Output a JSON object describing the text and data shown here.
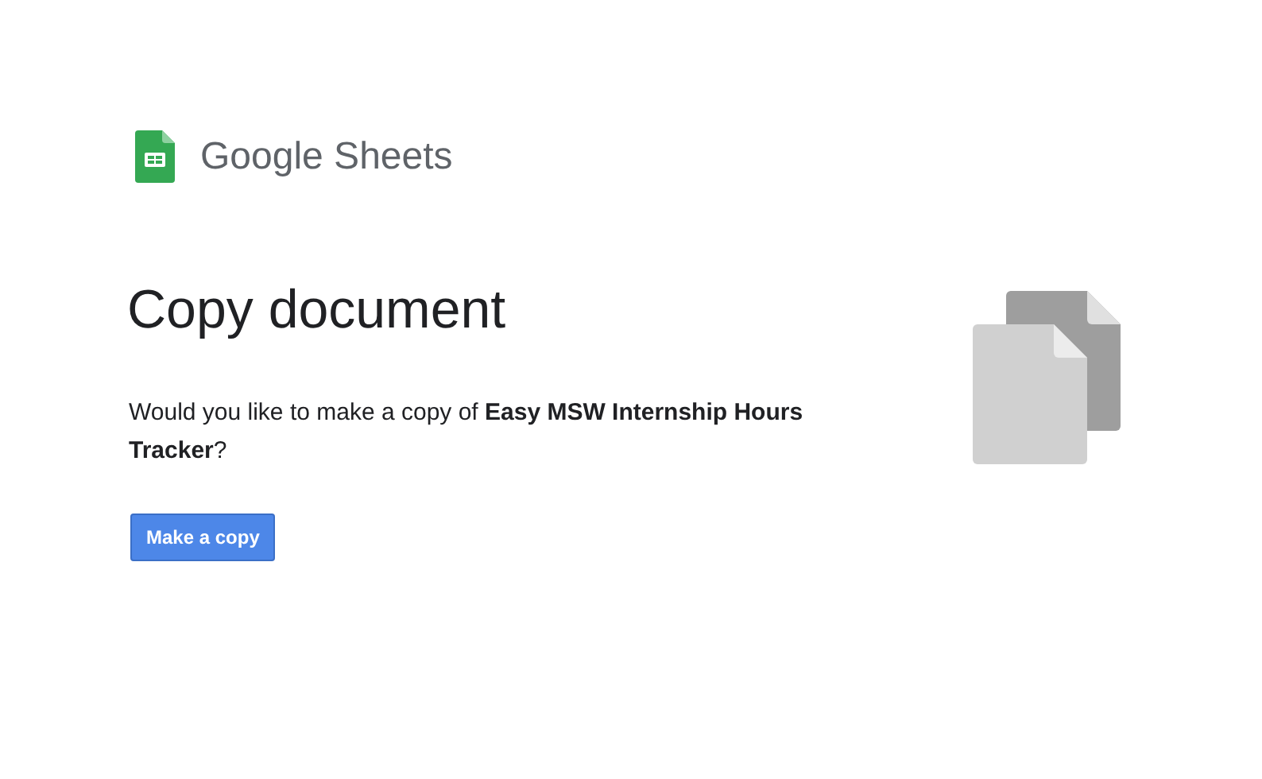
{
  "header": {
    "product": "Google Sheets"
  },
  "title": "Copy document",
  "message": "Would you like to make a copy of **Easy MSW Internship Hours Tracker**?",
  "buttons": [
    "Make a copy"
  ]
}
